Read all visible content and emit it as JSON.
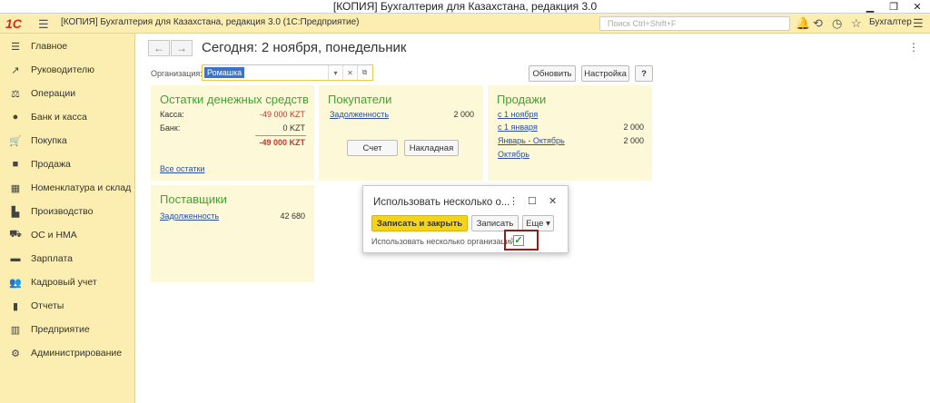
{
  "window": {
    "title": "[КОПИЯ] Бухгалтерия для Казахстана, редакция 3.0"
  },
  "header": {
    "logo": "1С",
    "app_title": "[КОПИЯ] Бухгалтерия для Казахстана, редакция 3.0  (1С:Предприятие)",
    "search_placeholder": "Поиск Ctrl+Shift+F",
    "user": "Бухгалтер"
  },
  "sidebar": {
    "items": [
      {
        "label": "Главное",
        "icon": "list-icon"
      },
      {
        "label": "Руководителю",
        "icon": "trend-icon"
      },
      {
        "label": "Операции",
        "icon": "operations-icon"
      },
      {
        "label": "Банк и касса",
        "icon": "coin-icon"
      },
      {
        "label": "Покупка",
        "icon": "cart-icon"
      },
      {
        "label": "Продажа",
        "icon": "bag-icon"
      },
      {
        "label": "Номенклатура и склад",
        "icon": "grid-icon"
      },
      {
        "label": "Производство",
        "icon": "factory-icon"
      },
      {
        "label": "ОС и НМА",
        "icon": "truck-icon"
      },
      {
        "label": "Зарплата",
        "icon": "wallet-icon"
      },
      {
        "label": "Кадровый учет",
        "icon": "people-icon"
      },
      {
        "label": "Отчеты",
        "icon": "chart-icon"
      },
      {
        "label": "Предприятие",
        "icon": "building-icon"
      },
      {
        "label": "Администрирование",
        "icon": "gear-icon"
      }
    ]
  },
  "main": {
    "title": "Сегодня: 2 ноября, понедельник",
    "org_label": "Организация:",
    "org_value": "Ромашка",
    "refresh_label": "Обновить",
    "settings_label": "Настройка",
    "help_label": "?"
  },
  "panels": {
    "cash": {
      "title": "Остатки денежных средств",
      "rows": [
        {
          "label": "Касса:",
          "value": "-49 000 KZT"
        },
        {
          "label": "Банк:",
          "value": "0 KZT"
        }
      ],
      "total": "-49 000 KZT",
      "link": "Все остатки"
    },
    "buyers": {
      "title": "Покупатели",
      "debt_label": "Задолженность",
      "debt_value": "2 000",
      "btn_invoice": "Счет",
      "btn_waybill": "Накладная"
    },
    "sales": {
      "title": "Продажи",
      "rows": [
        {
          "label": "с 1 ноября",
          "value": ""
        },
        {
          "label": "с 1 января",
          "value": "2 000"
        },
        {
          "label": "Январь - Октябрь",
          "value": "2 000"
        },
        {
          "label": "Октябрь",
          "value": ""
        }
      ]
    },
    "suppliers": {
      "title": "Поставщики",
      "debt_label": "Задолженность",
      "debt_value": "42 680"
    }
  },
  "dialog": {
    "title": "Использовать несколько о...",
    "save_close": "Записать и закрыть",
    "save": "Записать",
    "more": "Еще",
    "checkbox_label": "Использовать несколько организаций:",
    "checked": true
  }
}
